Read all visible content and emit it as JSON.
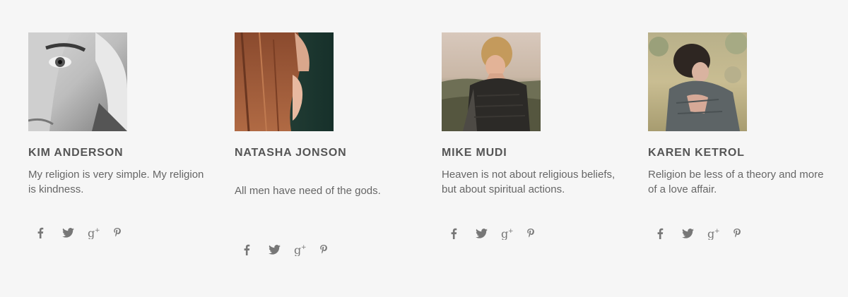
{
  "members": [
    {
      "name": "KIM ANDERSON",
      "quote": "My religion is very simple. My religion is kindness."
    },
    {
      "name": "NATASHA JONSON",
      "quote": "All men have need of the gods."
    },
    {
      "name": "MIKE MUDI",
      "quote": "Heaven is not about religious beliefs, but about spiritual actions."
    },
    {
      "name": "KAREN KETROL",
      "quote": "Religion be less of a theory and more of a love affair."
    }
  ],
  "social_icons": [
    "facebook-icon",
    "twitter-icon",
    "google-plus-icon",
    "pinterest-icon"
  ],
  "colors": {
    "background": "#f6f6f6",
    "name": "#555555",
    "text": "#666666",
    "icon": "#777777"
  }
}
